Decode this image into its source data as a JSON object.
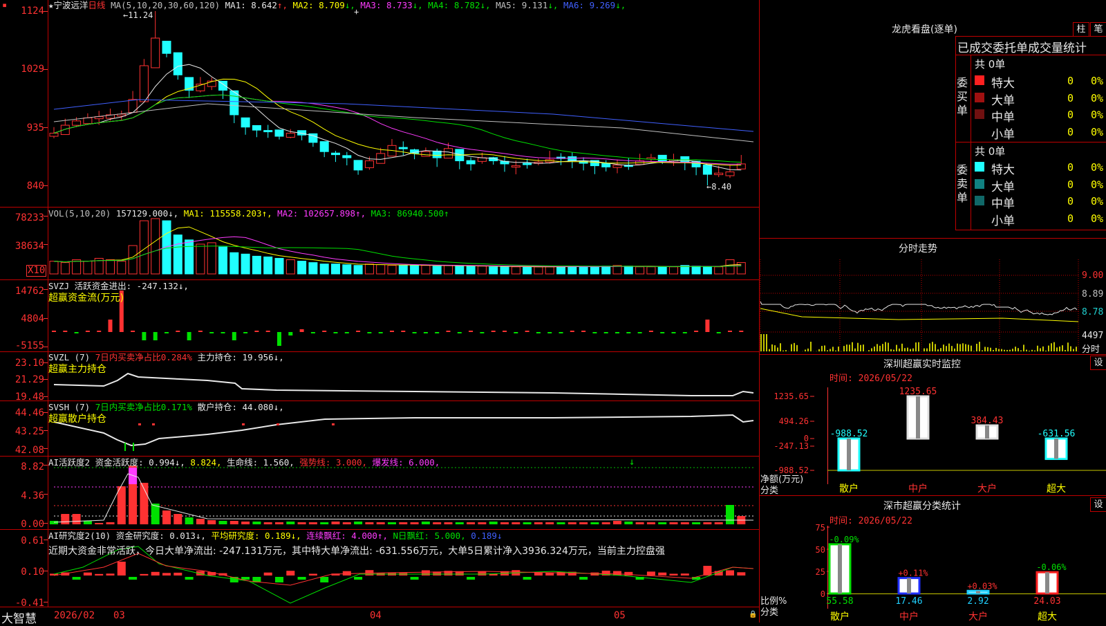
{
  "stock": {
    "name": "★宁波远洋",
    "period": "日线"
  },
  "ma_header": {
    "label": "MA(5,10,20,30,60,120)",
    "items": [
      {
        "text": "MA1: 8.642",
        "arrow": "↑",
        "color": "#e8e8e8"
      },
      {
        "text": "MA2: 8.709",
        "arrow": "↓",
        "color": "#ffff00"
      },
      {
        "text": "MA3: 8.733",
        "arrow": "↓",
        "color": "#ff3cff"
      },
      {
        "text": "MA4: 8.782",
        "arrow": "↓",
        "color": "#00e000"
      },
      {
        "text": "MA5: 9.131",
        "arrow": "↓",
        "color": "#c0c0c0"
      },
      {
        "text": "MA6: 9.269",
        "arrow": "↓",
        "color": "#4060ff"
      }
    ]
  },
  "price_axis": [
    "1124",
    "1029",
    "935",
    "840"
  ],
  "price_high_label": "←11.24",
  "price_low_label": "←8.40",
  "vol_header": {
    "label": "VOL(5,10,20)",
    "value": "157129.000↓,",
    "ma1": "MA1: 115558.203↑,",
    "ma2": "MA2: 102657.898↑,",
    "ma3": "MA3: 86940.500↑"
  },
  "vol_axis": [
    "78233",
    "38634"
  ],
  "vol_unit": "X10",
  "svzj": {
    "label": "SVZJ  活跃资金进出: -247.132↓,",
    "subtitle": "超赢资金流(万元)",
    "axis": [
      "14762",
      "4804",
      "-5155"
    ]
  },
  "svzl": {
    "label1": "SVZL (7)",
    "label2": "7日内买卖净占比0.284%",
    "label3": "主力持仓: 19.956↓,",
    "subtitle": "超赢主力持仓",
    "axis": [
      "23.10",
      "21.29",
      "19.48"
    ]
  },
  "svsh": {
    "label1": "SVSH (7)",
    "label2": "7日内买卖净占比0.171%",
    "label3": "散户持仓: 44.080↓,",
    "subtitle": "超赢散户持仓",
    "axis": [
      "44.46",
      "43.25",
      "42.08"
    ]
  },
  "ai2": {
    "label": "AI活跃度2 资金活跃度: 0.994↓,",
    "v2": "8.824,",
    "v3": "生命线: 1.560,",
    "v4": "强势线: 3.000,",
    "v5": "爆发线: 6.000,",
    "axis": [
      "8.82",
      "4.36",
      "0.00"
    ]
  },
  "ai_research": {
    "label": "AI研究度2(10) 资金研究度: 0.013↓,",
    "v2": "平均研究度: 0.189↓,",
    "v3": "连续飘红: 4.000↑,",
    "v4": "N日飘红: 5.000,",
    "v5": "0.189↓",
    "comment": "近期大资金非常活跃，今日大单净流出: -247.131万元，其中特大单净流出: -631.556万元，大单5日累计净入3936.324万元，当前主力控盘强",
    "axis": [
      "0.61",
      "0.10",
      "-0.41"
    ]
  },
  "dates": [
    "2026/02",
    "03",
    "04",
    "05"
  ],
  "brand": "大智慧",
  "longhu": {
    "title": "龙虎看盘(逐单)",
    "btn1": "柱",
    "btn2": "笔",
    "subtitle": "已成交委托单成交量统计",
    "buy": {
      "side": "委买单",
      "total": "共 0单",
      "rows": [
        {
          "label": "特大",
          "value": "0",
          "pct": "0%",
          "color": "#ff2020"
        },
        {
          "label": "大单",
          "value": "0",
          "pct": "0%",
          "color": "#a01010"
        },
        {
          "label": "中单",
          "value": "0",
          "pct": "0%",
          "color": "#701010"
        },
        {
          "label": "小单",
          "value": "0",
          "pct": "0%",
          "color": "#000000"
        }
      ]
    },
    "sell": {
      "side": "委卖单",
      "total": "共 0单",
      "rows": [
        {
          "label": "特大",
          "value": "0",
          "pct": "0%",
          "color": "#20ffff"
        },
        {
          "label": "大单",
          "value": "0",
          "pct": "0%",
          "color": "#108080"
        },
        {
          "label": "中单",
          "value": "0",
          "pct": "0%",
          "color": "#106868"
        },
        {
          "label": "小单",
          "value": "0",
          "pct": "0%",
          "color": "#000000"
        }
      ]
    }
  },
  "fenshi": {
    "title": "分时走势",
    "axis": [
      "9.00",
      "8.89",
      "8.78"
    ],
    "vol": "4497",
    "unit": "分时"
  },
  "monitor": {
    "title": "深圳超赢实时监控",
    "settings": "设",
    "time": "时间: 2026/05/22",
    "axis": [
      "1235.65",
      "494.26",
      "0",
      "-247.13",
      "-988.52"
    ],
    "ylabel": "净额(万元)",
    "xlabel": "分类",
    "bars": [
      {
        "name": "散户",
        "value": -988.52,
        "label": "-988.52"
      },
      {
        "name": "中户",
        "value": 1235.65,
        "label": "1235.65"
      },
      {
        "name": "大户",
        "value": 384.43,
        "label": "384.43"
      },
      {
        "name": "超大",
        "value": -631.56,
        "label": "-631.56"
      }
    ]
  },
  "classify": {
    "title": "深市超赢分类统计",
    "settings": "设",
    "time": "时间: 2026/05/22",
    "axis": [
      "75",
      "50",
      "25",
      "0"
    ],
    "ylabel": "比例%",
    "xlabel": "分类",
    "bars": [
      {
        "name": "散户",
        "value": 55.58,
        "label": "55.58",
        "delta": "-0.09%"
      },
      {
        "name": "中户",
        "value": 17.46,
        "label": "17.46",
        "delta": "+0.11%"
      },
      {
        "name": "大户",
        "value": 2.92,
        "label": "2.92",
        "delta": "+0.03%"
      },
      {
        "name": "超大",
        "value": 24.03,
        "label": "24.03",
        "delta": "-0.06%"
      }
    ]
  }
}
